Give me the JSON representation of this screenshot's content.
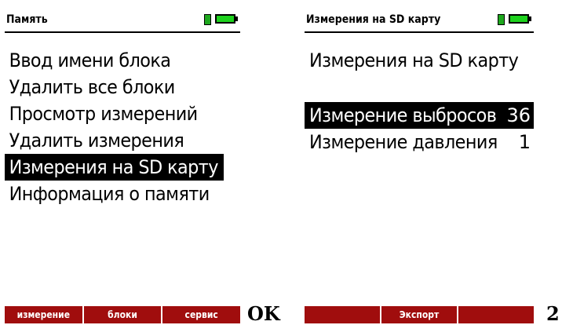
{
  "screen1": {
    "title": "Память",
    "menu": [
      {
        "label": "Ввод имени блока"
      },
      {
        "label": "Удалить все блоки"
      },
      {
        "label": "Просмотр измерений"
      },
      {
        "label": "Удалить измерения"
      },
      {
        "label": "Измерения на SD карту",
        "selected": true
      },
      {
        "label": "Информация о памяти"
      }
    ],
    "softkeys": [
      "измерение",
      "блоки",
      "сервис"
    ]
  },
  "ok_label": "OK",
  "screen2": {
    "title": "Измерения на SD карту",
    "heading": "Измерения на SD карту",
    "items": [
      {
        "label": "Измерение выбросов",
        "count": "36",
        "selected": true
      },
      {
        "label": "Измерение давления",
        "count": "1"
      }
    ],
    "softkeys": [
      "",
      "Экспорт",
      ""
    ]
  },
  "key2_label": "2",
  "colors": {
    "softkey_bg": "#a00d0d",
    "battery": "#1ed21e",
    "selection_bg": "#000000",
    "selection_fg": "#ffffff"
  },
  "icons": [
    "plug-icon",
    "battery-icon"
  ]
}
